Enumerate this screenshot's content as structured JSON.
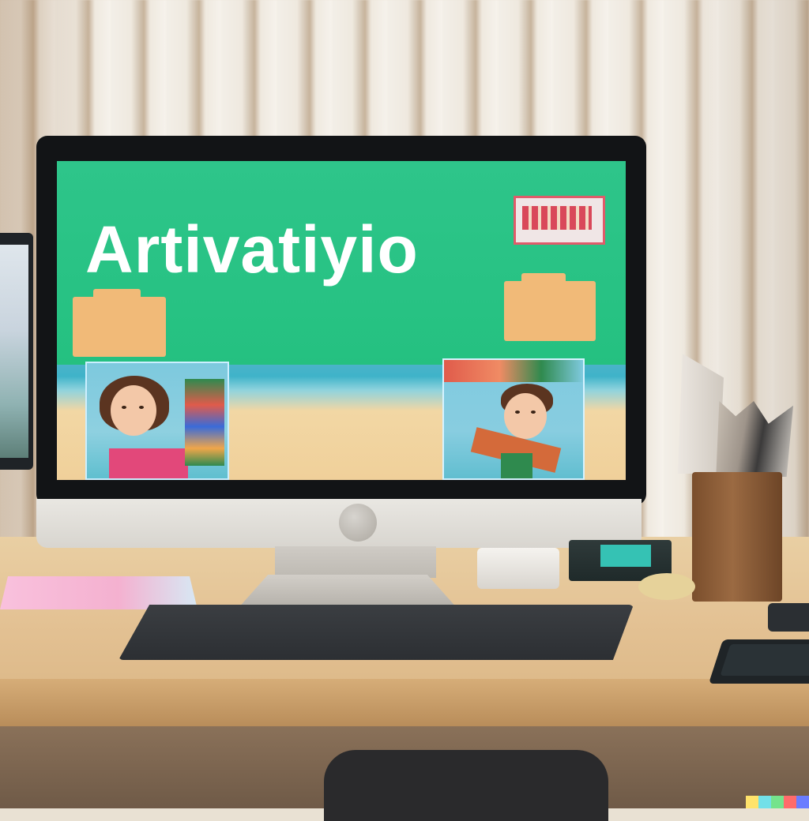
{
  "screen": {
    "title": "Artivatiyio"
  },
  "colors": {
    "screen_green": "#2ec58a",
    "folder": "#f1ba78",
    "sign_red": "#e05b6a",
    "desk": "#e3c193"
  }
}
